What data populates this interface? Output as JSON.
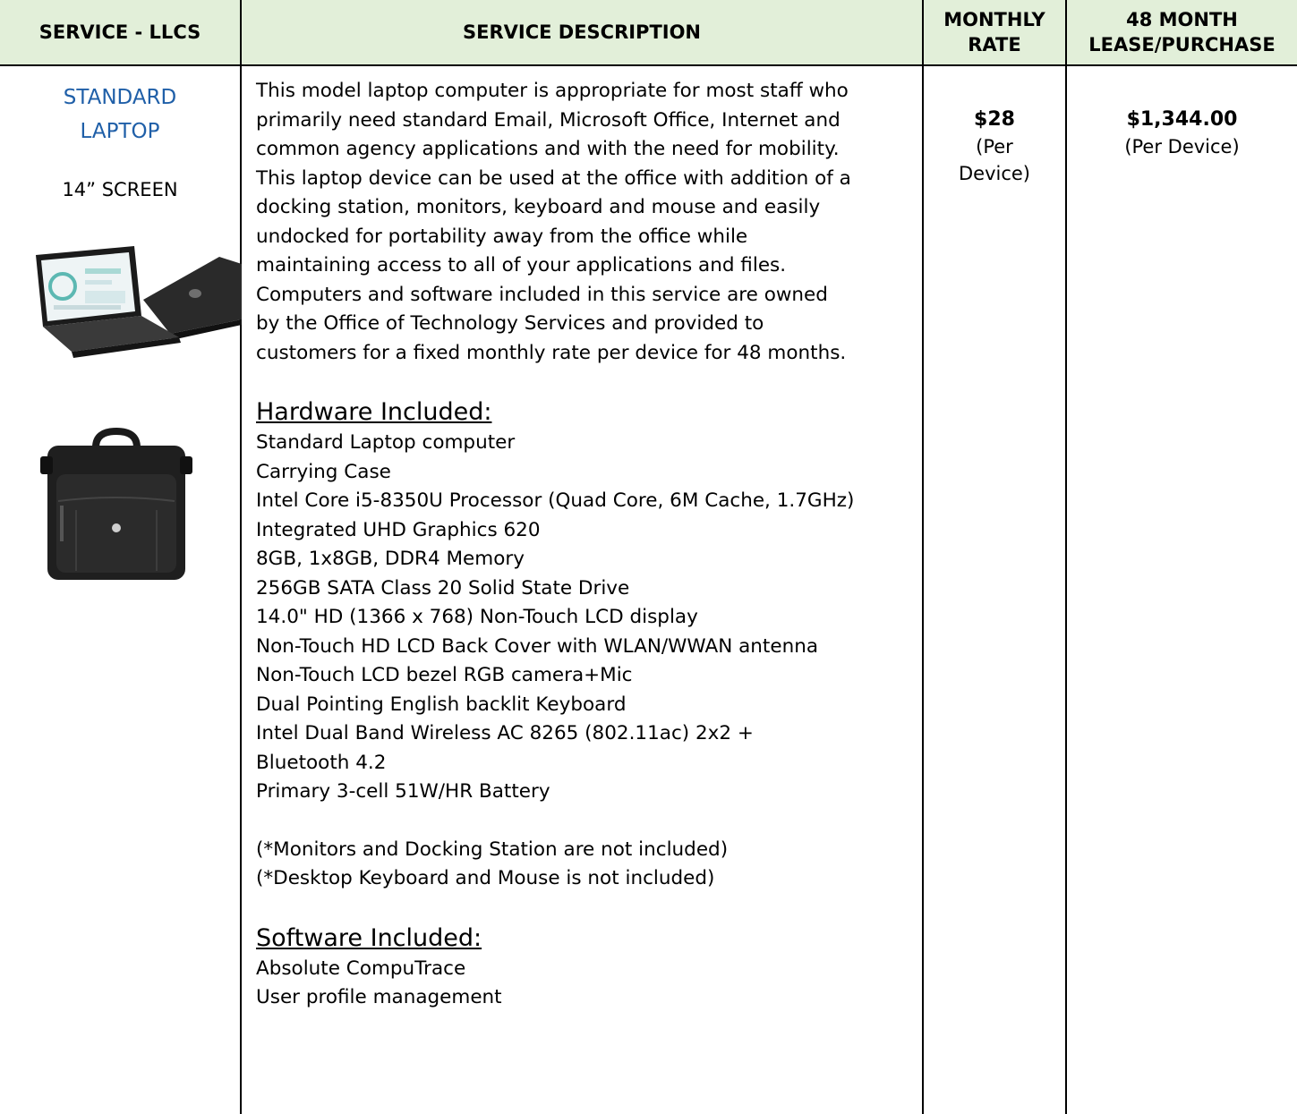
{
  "headers": {
    "col1": "SERVICE - LLCS",
    "col2": "SERVICE DESCRIPTION",
    "col3_line1": "MONTHLY",
    "col3_line2": "RATE",
    "col4_line1": "48 MONTH",
    "col4_line2": "LEASE/PURCHASE"
  },
  "service": {
    "name_line1": "STANDARD",
    "name_line2": "LAPTOP",
    "screen": "14” SCREEN"
  },
  "description": {
    "lines": [
      "This model laptop computer is appropriate for most staff who",
      "primarily need standard Email, Microsoft Office, Internet and",
      "common agency applications and with the need for mobility.",
      "This laptop device can be used at the office with addition of a",
      "docking station, monitors, keyboard and mouse and easily",
      "undocked for portability away from the office while",
      "maintaining access to all of your applications and files.",
      "Computers and software included in this service are owned",
      "by the Office of Technology Services and provided to",
      "customers for a fixed monthly rate per device for 48 months."
    ]
  },
  "hardware": {
    "heading": "Hardware Included:",
    "items": [
      "Standard Laptop computer",
      "Carrying Case",
      "Intel Core i5-8350U Processor (Quad Core, 6M Cache, 1.7GHz)",
      "Integrated UHD Graphics 620",
      "8GB, 1x8GB, DDR4 Memory",
      "256GB SATA Class 20 Solid State Drive",
      "14.0\" HD (1366 x 768) Non-Touch LCD display",
      "Non-Touch HD LCD Back Cover with WLAN/WWAN antenna",
      "Non-Touch LCD bezel RGB camera+Mic",
      "Dual Pointing English backlit Keyboard",
      "Intel Dual Band Wireless AC 8265 (802.11ac) 2x2 +",
      "Bluetooth 4.2",
      "Primary 3-cell 51W/HR Battery"
    ],
    "notes": [
      "(*Monitors and Docking Station are not included)",
      "(*Desktop Keyboard and Mouse is not included)"
    ]
  },
  "software": {
    "heading": "Software Included:",
    "items": [
      "Absolute CompuTrace",
      "User profile management"
    ]
  },
  "rate": {
    "amount": "$28",
    "unit_line1": "(Per",
    "unit_line2": "Device)"
  },
  "lease": {
    "amount": "$1,344.00",
    "unit": "(Per Device)"
  },
  "colors": {
    "header_bg": "#e2efd9",
    "service_name": "#1f5fa8"
  }
}
